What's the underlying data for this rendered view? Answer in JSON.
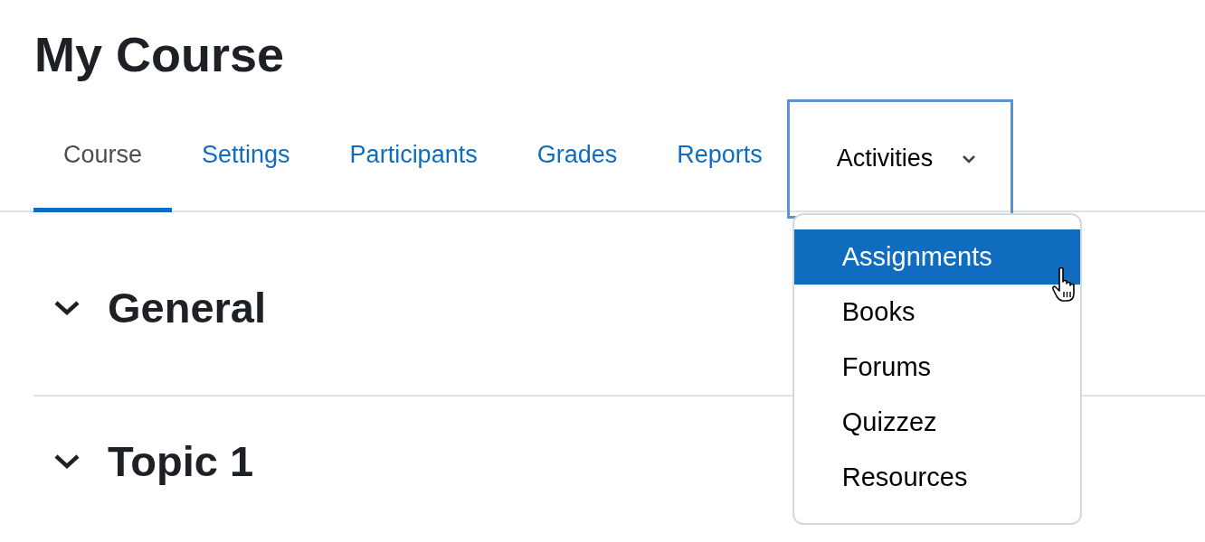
{
  "page_title": "My Course",
  "tabs": [
    {
      "label": "Course",
      "selected": true,
      "kind": "link"
    },
    {
      "label": "Settings",
      "selected": false,
      "kind": "link"
    },
    {
      "label": "Participants",
      "selected": false,
      "kind": "link"
    },
    {
      "label": "Grades",
      "selected": false,
      "kind": "link"
    },
    {
      "label": "Reports",
      "selected": false,
      "kind": "link"
    },
    {
      "label": "Activities",
      "selected": false,
      "kind": "dropdown",
      "focused": true,
      "expanded": true,
      "menu": [
        {
          "label": "Assignments",
          "selected": true
        },
        {
          "label": "Books",
          "selected": false
        },
        {
          "label": "Forums",
          "selected": false
        },
        {
          "label": "Quizzez",
          "selected": false
        },
        {
          "label": "Resources",
          "selected": false
        }
      ]
    }
  ],
  "sections": [
    {
      "title": "General",
      "expanded": true
    },
    {
      "title": "Topic 1",
      "expanded": true
    }
  ]
}
